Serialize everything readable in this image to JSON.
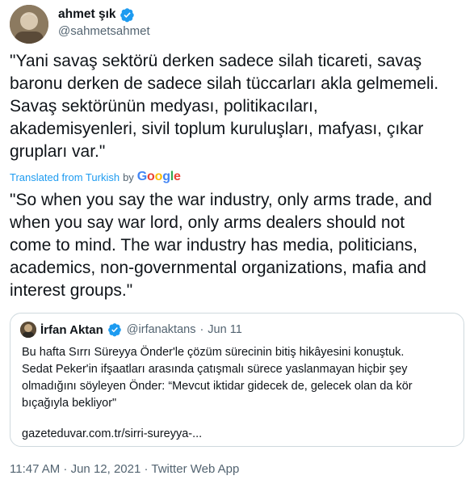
{
  "author": {
    "name": "ahmet şık",
    "handle": "@sahmetsahmet"
  },
  "tweet": {
    "text": "\"Yani savaş sektörü derken sadece silah ticareti, savaş\nbaronu derken de sadece silah tüccarları akla gelmemeli.\nSavaş sektörünün medyası, politikacıları,\nakademisyenleri, sivil toplum kuruluşları, mafyası, çıkar\ngrupları var.\"",
    "translated_label": "Translated from Turkish",
    "translated_by": "by",
    "translator": "Google",
    "translation": "\"So when you say the war industry, only arms trade, and\nwhen you say war lord, only arms dealers should not\ncome to mind. The war industry has media, politicians,\nacademics, non-governmental organizations, mafia and\ninterest groups.\""
  },
  "quote": {
    "name": "İrfan Aktan",
    "handle": "@irfanaktans",
    "separator": "·",
    "date": "Jun 11",
    "body": "Bu hafta Sırrı Süreyya Önder'le çözüm sürecinin bitiş hikâyesini konuştuk.\nSedat Peker'in ifşaatları arasında çatışmalı sürece yaslanmayan hiçbir şey\nolmadığını söyleyen Önder: “Mevcut iktidar gidecek de, gelecek olan da kör\nbıçağıyla bekliyor\"",
    "link": "gazeteduvar.com.tr/sirri-sureyya-..."
  },
  "footer": {
    "text": "11:47 AM · Jun 12, 2021 · Twitter Web App"
  },
  "colors": {
    "verified": "#1d9bf0",
    "link": "#1d9bf0",
    "muted": "#536471",
    "border": "#cfd9de"
  }
}
